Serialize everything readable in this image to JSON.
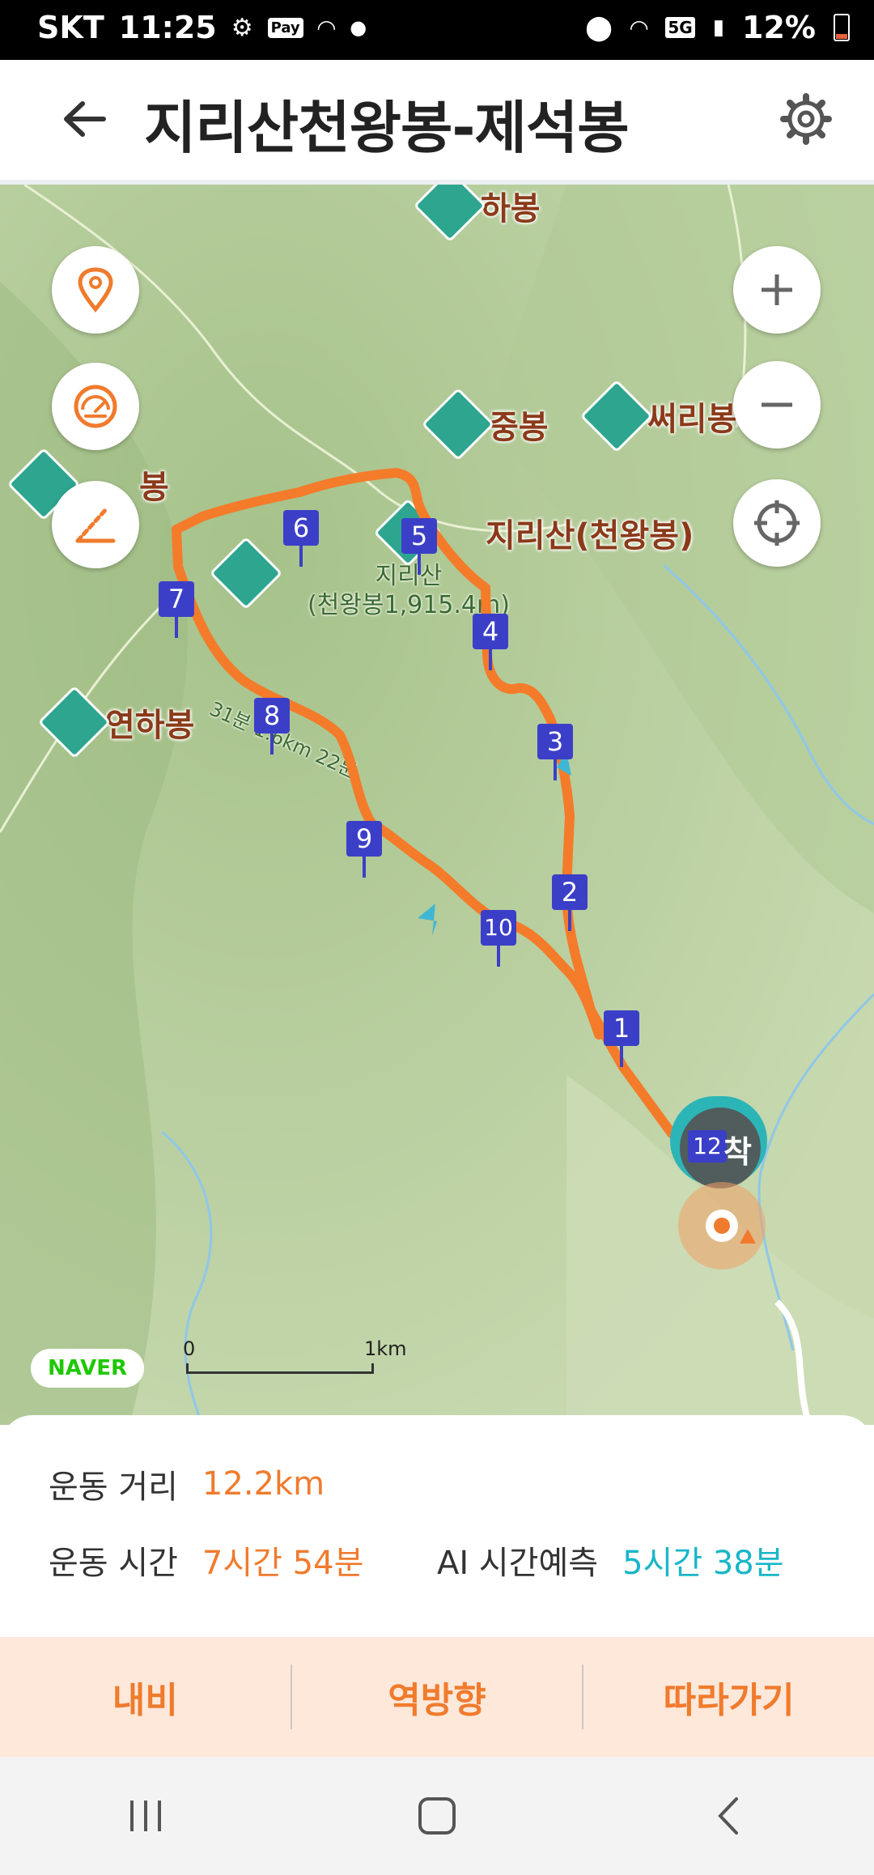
{
  "status_bar": {
    "carrier": "SKT",
    "time": "11:25",
    "pay_label": "Pay",
    "network": "5G",
    "battery": "12%"
  },
  "app_bar": {
    "title": "지리산천왕봉-제석봉",
    "back_icon": "arrow-left-icon",
    "settings_icon": "gear-icon"
  },
  "map": {
    "peaks": [
      {
        "name": "하봉"
      },
      {
        "name": "중봉"
      },
      {
        "name": "써리봉"
      },
      {
        "name": "지리산(천왕봉)"
      },
      {
        "name": "연하봉"
      },
      {
        "name": "봉"
      }
    ],
    "summit_caption_line1": "지리산",
    "summit_caption_line2": "(천왕봉1,915.4m)",
    "trail_caption": "31분 1.6km 22분",
    "end_label": "착",
    "waypoints": [
      "1",
      "2",
      "3",
      "4",
      "5",
      "6",
      "7",
      "8",
      "9",
      "10",
      "12"
    ],
    "provider": "NAVER",
    "scale_start": "0",
    "scale_end": "1km",
    "route_color": "#f47b2a",
    "marker_color": "#3b3fc8"
  },
  "summary": {
    "distance_label": "운동 거리",
    "distance_value": "12.2km",
    "time_label": "운동 시간",
    "time_value": "7시간 54분",
    "ai_label": "AI 시간예측",
    "ai_value": "5시간 38분"
  },
  "actions": {
    "navi": "내비",
    "reverse": "역방향",
    "follow": "따라가기"
  },
  "nav_bar": {
    "recent_icon": "recent-apps-icon",
    "home_icon": "home-icon",
    "back_icon": "back-chevron-icon"
  }
}
